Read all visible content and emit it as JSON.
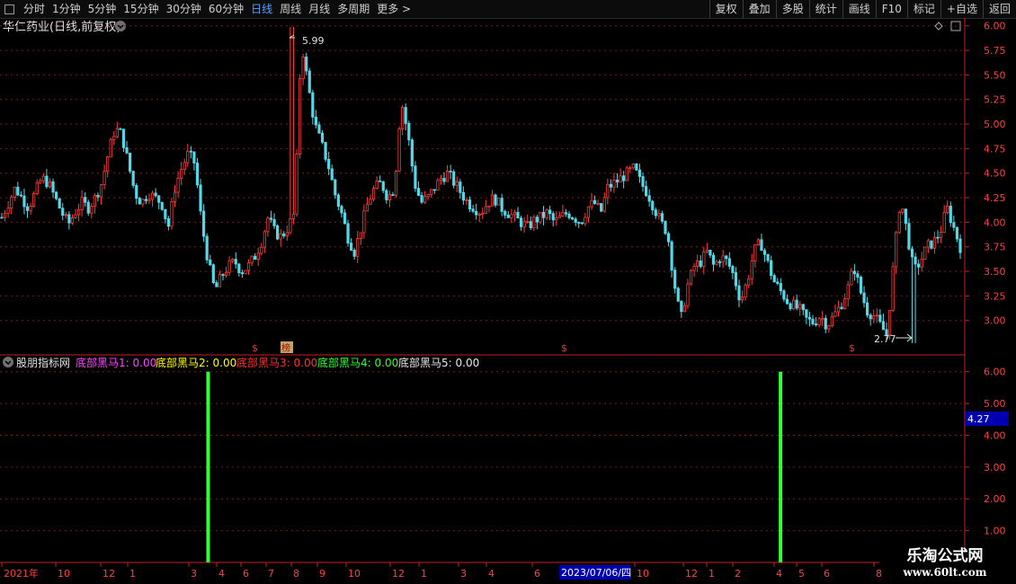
{
  "toolbar": {
    "tabs": [
      "分时",
      "1分钟",
      "5分钟",
      "15分钟",
      "30分钟",
      "60分钟",
      "日线",
      "周线",
      "月线",
      "多周期",
      "更多 >"
    ],
    "active": "日线",
    "right_buttons": [
      "复权",
      "叠加",
      "多股",
      "统计",
      "画线",
      "F10",
      "标记",
      "+自选",
      "返回"
    ]
  },
  "main_pane": {
    "title": "华仁药业(日线,前复权)",
    "high_label": "5.99",
    "low_label": "2.77",
    "price_badge": "4.27",
    "markers": [
      "$",
      "榜",
      "$",
      "$"
    ]
  },
  "indicator_pane": {
    "title": "股朋指标网",
    "series_labels": [
      {
        "text": "底部黑马1: 0.00",
        "color": "#ff44ff"
      },
      {
        "text": "底部黑马2: 0.00",
        "color": "#ffff00"
      },
      {
        "text": "底部黑马3: 0.00",
        "color": "#ff3030"
      },
      {
        "text": "底部黑马4: 0.00",
        "color": "#33ff33"
      },
      {
        "text": "底部黑马5: 0.00",
        "color": "#e8e8e8"
      }
    ]
  },
  "date_axis": {
    "highlight": "2023/07/06/四",
    "ticks": [
      "2021年",
      "10",
      "12",
      "1",
      "3",
      "4",
      "6",
      "7",
      "8",
      "9",
      "10",
      "12",
      "1",
      "3",
      "4",
      "6",
      "10",
      "12",
      "1",
      "2",
      "4",
      "5",
      "6",
      "8"
    ]
  },
  "watermark": {
    "line1": "乐淘公式网",
    "line2": "www.60lt.com"
  },
  "chart_data": {
    "type": "candlestick",
    "title": "华仁药业(日线,前复权)",
    "price_ylim": [
      2.65,
      6.08
    ],
    "price_ticks": [
      3.0,
      3.25,
      3.5,
      3.75,
      4.0,
      4.25,
      4.5,
      4.75,
      5.0,
      5.25,
      5.5,
      5.75,
      6.0
    ],
    "high": 5.99,
    "low": 2.77,
    "close_path": [
      4.05,
      4.2,
      4.35,
      4.25,
      4.15,
      4.3,
      4.45,
      4.4,
      4.25,
      4.1,
      3.98,
      4.1,
      4.2,
      4.15,
      4.25,
      4.4,
      4.7,
      4.95,
      4.9,
      4.6,
      4.3,
      4.2,
      4.3,
      4.25,
      4.2,
      3.95,
      4.35,
      4.55,
      4.7,
      4.6,
      4.0,
      3.6,
      3.3,
      3.45,
      3.55,
      3.6,
      3.5,
      3.55,
      3.65,
      3.8,
      4.05,
      3.9,
      3.85,
      3.95,
      4.1,
      5.85,
      5.4,
      5.0,
      4.8,
      4.6,
      4.3,
      4.1,
      3.85,
      3.7,
      3.95,
      4.2,
      4.35,
      4.4,
      4.25,
      4.35,
      5.25,
      4.9,
      4.4,
      4.2,
      4.25,
      4.35,
      4.45,
      4.5,
      4.4,
      4.3,
      4.2,
      4.15,
      4.1,
      4.2,
      4.25,
      4.15,
      4.1,
      4.05,
      4.0,
      3.95,
      4.02,
      4.05,
      4.1,
      4.0,
      4.05,
      4.1,
      4.05,
      4.0,
      4.15,
      4.2,
      4.1,
      4.35,
      4.4,
      4.45,
      4.5,
      4.55,
      4.4,
      4.3,
      4.15,
      4.0,
      3.9,
      3.4,
      3.0,
      3.35,
      3.55,
      3.6,
      3.7,
      3.55,
      3.65,
      3.6,
      3.45,
      3.2,
      3.4,
      3.7,
      3.8,
      3.6,
      3.4,
      3.3,
      3.2,
      3.15,
      3.1,
      3.0,
      2.98,
      3.05,
      2.95,
      3.05,
      3.15,
      3.3,
      3.55,
      3.3,
      3.1,
      3.05,
      2.95,
      2.85,
      3.6,
      4.25,
      3.9,
      3.5,
      3.6,
      3.75,
      3.8,
      3.9,
      4.15,
      3.95,
      3.75
    ],
    "indicator": {
      "ylim": [
        0,
        6.5
      ],
      "ticks": [
        1.0,
        2.0,
        3.0,
        4.0,
        5.0,
        6.0
      ],
      "signals": [
        {
          "index": 31,
          "value": 6.0,
          "color": "#33ff33"
        },
        {
          "index": 117,
          "value": 6.0,
          "color": "#33ff33"
        }
      ]
    }
  }
}
